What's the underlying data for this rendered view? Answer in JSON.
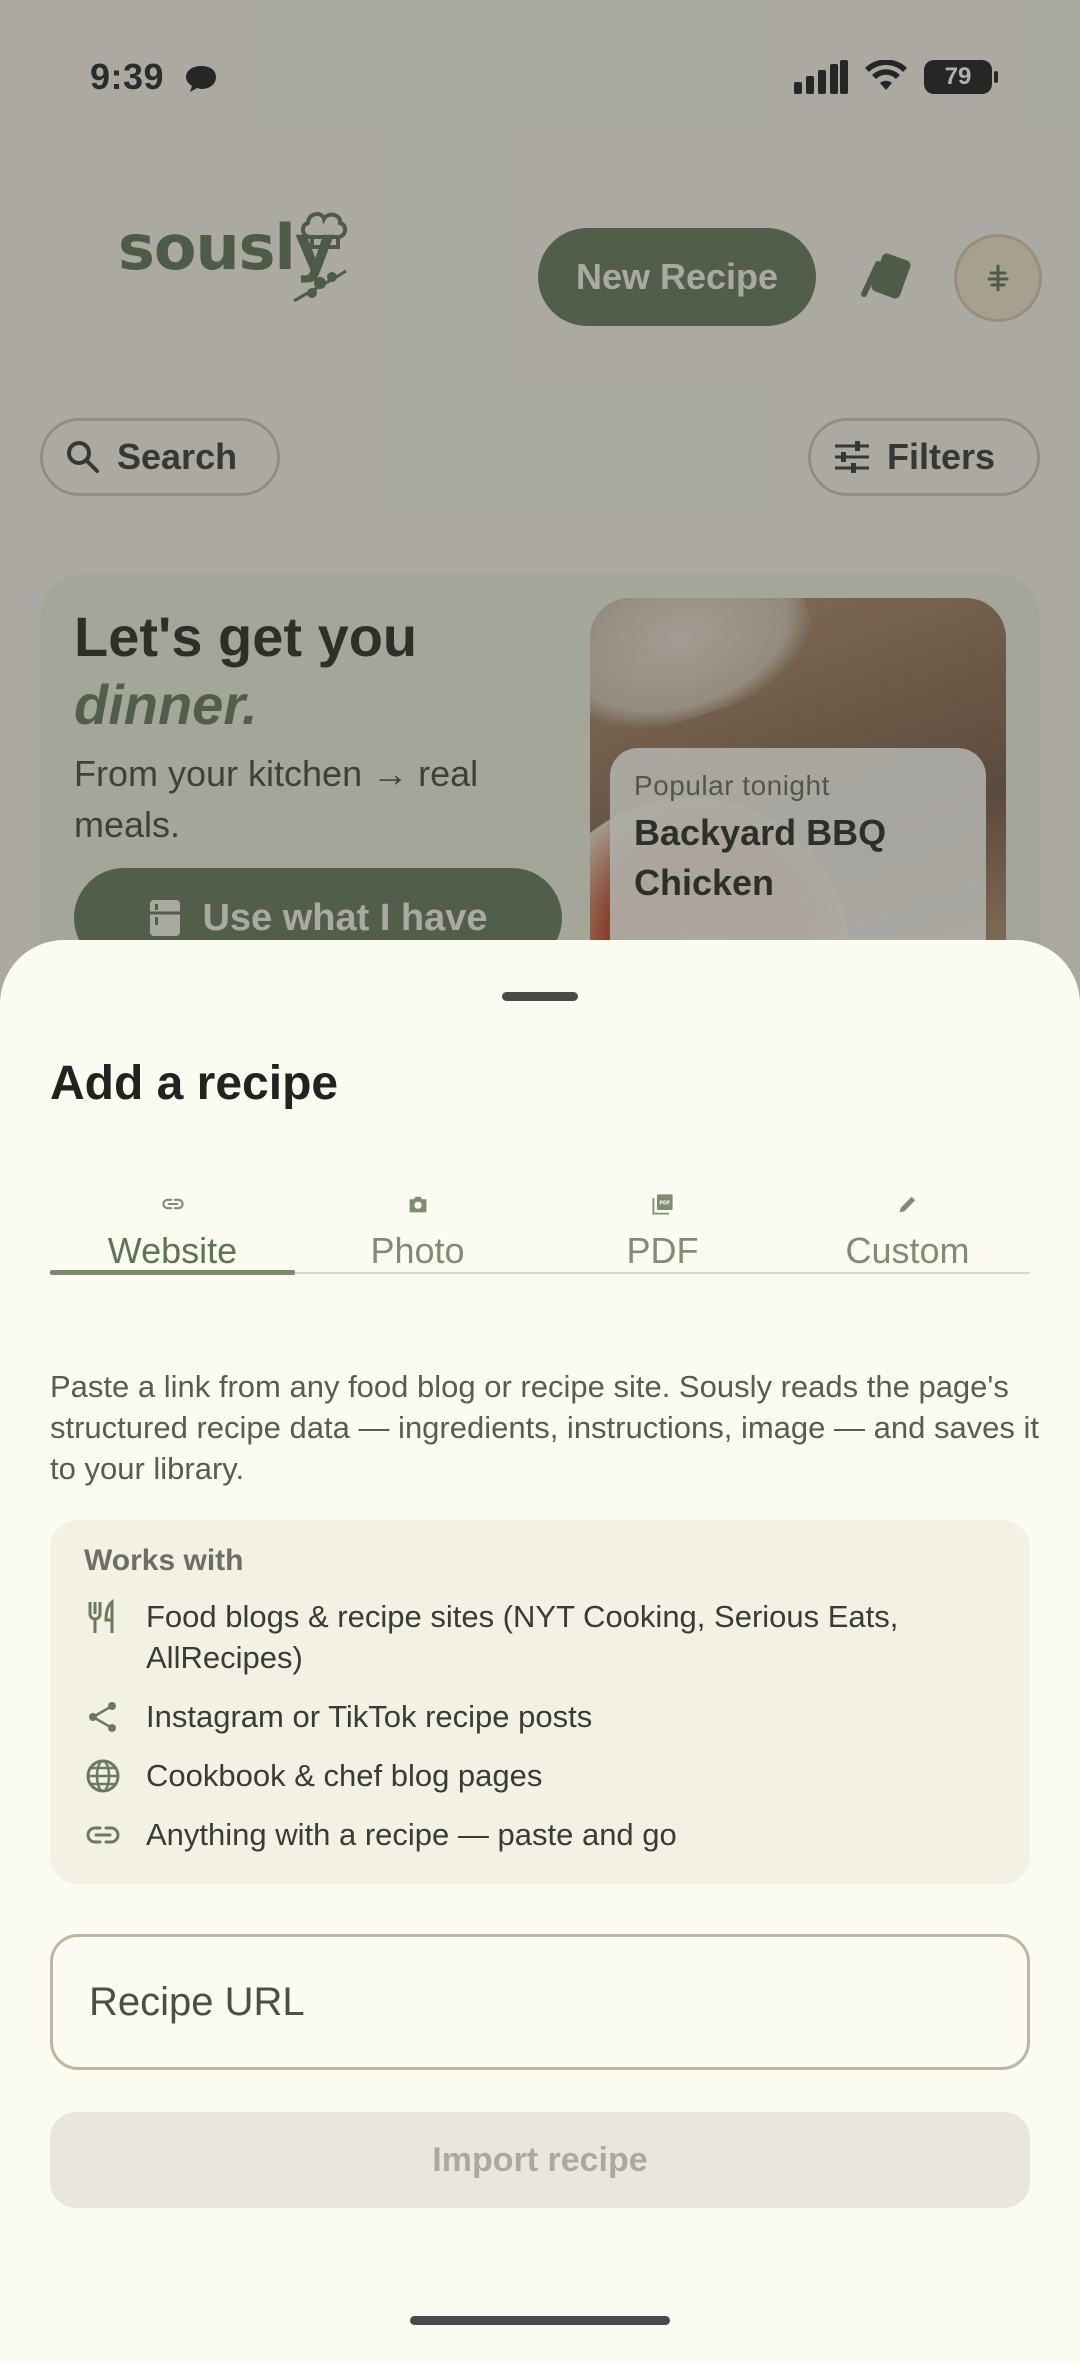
{
  "status_bar": {
    "time": "9:39",
    "battery": "79"
  },
  "header": {
    "logo": "sously",
    "new_recipe_label": "New Recipe"
  },
  "toolbar": {
    "search_label": "Search",
    "filters_label": "Filters"
  },
  "hero": {
    "title_line1": "Let's get you",
    "title_line2": "dinner.",
    "subtitle": "From your kitchen → real meals.",
    "button_label": "Use what I have",
    "popular_label": "Popular tonight",
    "popular_title": "Backyard BBQ Chicken"
  },
  "sheet": {
    "title": "Add a recipe",
    "tabs": [
      {
        "label": "Website",
        "icon": "link-icon"
      },
      {
        "label": "Photo",
        "icon": "camera-icon"
      },
      {
        "label": "PDF",
        "icon": "pdf-icon"
      },
      {
        "label": "Custom",
        "icon": "pencil-icon"
      }
    ],
    "active_tab": "Website",
    "description": "Paste a link from any food blog or recipe site. Sously reads the page's structured recipe data — ingredients, instructions, image — and saves it to your library.",
    "works_with": {
      "title": "Works with",
      "items": [
        {
          "text": "Food blogs & recipe sites (NYT Cooking, Serious Eats, AllRecipes)",
          "icon": "utensils-icon"
        },
        {
          "text": "Instagram or TikTok recipe posts",
          "icon": "share-icon"
        },
        {
          "text": "Cookbook & chef blog pages",
          "icon": "globe-icon"
        },
        {
          "text": "Anything with a recipe — paste and go",
          "icon": "link-icon"
        }
      ]
    },
    "url_placeholder": "Recipe URL",
    "url_value": "",
    "import_label": "Import recipe"
  },
  "colors": {
    "accent": "#5a7050",
    "sheet_bg": "#fcfbf2",
    "muted_tab": "#7f8e72"
  }
}
